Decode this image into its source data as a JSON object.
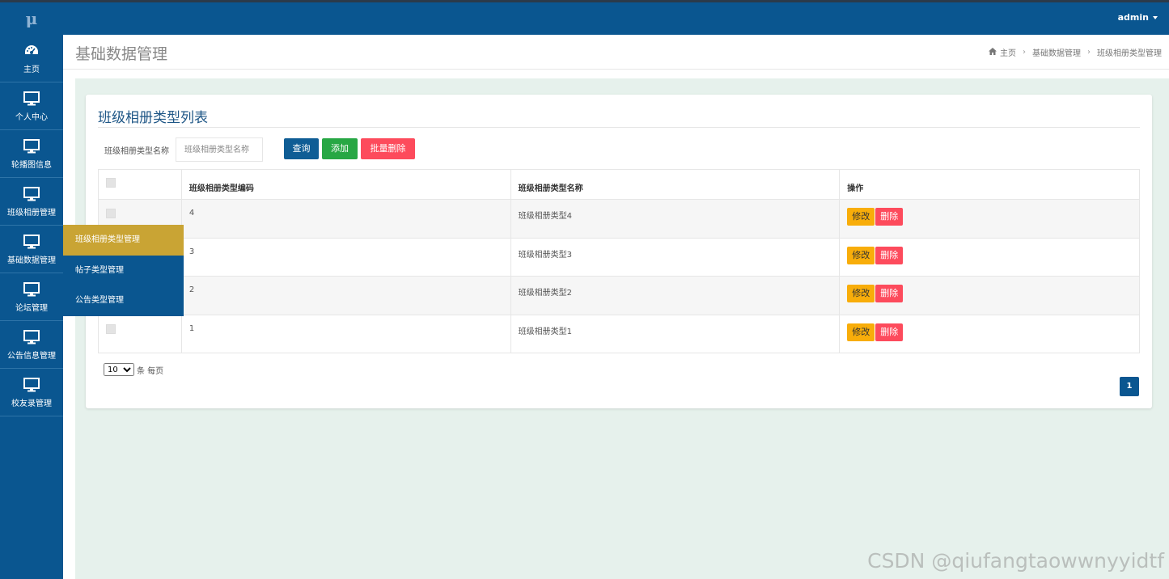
{
  "app": {
    "logo": "μ",
    "user": "admin"
  },
  "sidebar": {
    "items": [
      {
        "label": "主页",
        "icon": "dashboard-icon"
      },
      {
        "label": "个人中心",
        "icon": "monitor-icon"
      },
      {
        "label": "轮播图信息",
        "icon": "monitor-icon"
      },
      {
        "label": "班级相册管理",
        "icon": "monitor-icon"
      },
      {
        "label": "基础数据管理",
        "icon": "monitor-icon"
      },
      {
        "label": "论坛管理",
        "icon": "monitor-icon"
      },
      {
        "label": "公告信息管理",
        "icon": "monitor-icon"
      },
      {
        "label": "校友录管理",
        "icon": "monitor-icon"
      }
    ]
  },
  "flyout": {
    "items": [
      {
        "label": "班级相册类型管理",
        "active": true
      },
      {
        "label": "帖子类型管理",
        "active": false
      },
      {
        "label": "公告类型管理",
        "active": false
      }
    ]
  },
  "header": {
    "title": "基础数据管理",
    "breadcrumb": [
      "主页",
      "基础数据管理",
      "班级相册类型管理"
    ]
  },
  "card": {
    "title": "班级相册类型列表",
    "search_label": "班级相册类型名称",
    "search_placeholder": "班级相册类型名称",
    "query_label": "查询",
    "add_label": "添加",
    "batch_delete_label": "批量删除"
  },
  "table": {
    "columns": [
      "",
      "班级相册类型编码",
      "班级相册类型名称",
      "操作"
    ],
    "rows": [
      {
        "code": "4",
        "name": "班级相册类型4"
      },
      {
        "code": "3",
        "name": "班级相册类型3"
      },
      {
        "code": "2",
        "name": "班级相册类型2"
      },
      {
        "code": "1",
        "name": "班级相册类型1"
      }
    ],
    "edit_label": "修改",
    "delete_label": "删除"
  },
  "pager": {
    "page_size": "10",
    "per_page_label": "条 每页",
    "current_page": "1"
  },
  "watermark": "CSDN @qiufangtaowwnyyidtf",
  "colors": {
    "brand": "#0a5690",
    "active": "#c9a434",
    "add": "#27a744",
    "danger": "#fd4b5c",
    "warn": "#f8ad0a"
  }
}
